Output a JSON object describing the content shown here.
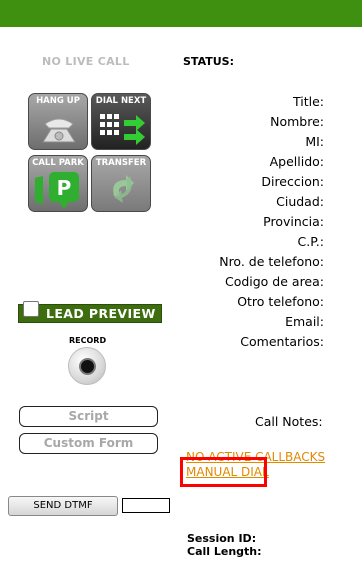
{
  "live_call_status": "NO LIVE CALL",
  "status_label": "STATUS:",
  "buttons": {
    "hang_up": "HANG UP",
    "dial_next": "DIAL NEXT",
    "call_park": "CALL PARK",
    "transfer": "TRANSFER"
  },
  "lead_fields": [
    "Title:",
    "Nombre:",
    "MI:",
    "Apellido:",
    "Direccion:",
    "Ciudad:",
    "Provincia:",
    "C.P.:",
    "Nro. de telefono:",
    "Codigo de area:",
    "Otro telefono:",
    "Email:",
    "Comentarios:"
  ],
  "lead_preview": {
    "label": "LEAD PREVIEW",
    "checked": false
  },
  "record_label": "RECORD",
  "script_button": "Script",
  "custom_form_button": "Custom Form",
  "call_notes_label": "Call Notes:",
  "callbacks_link": "NO ACTIVE CALLBACKS",
  "manual_dial_link": "MANUAL DIAL",
  "send_dtmf_button": "SEND DTMF",
  "dtmf_input_value": "",
  "session_id_label": "Session ID:",
  "call_length_label": "Call Length:",
  "colors": {
    "top_bar": "#3f8f10",
    "lead_preview_bg": "#3d6d0f",
    "link": "#e08a00",
    "highlight": "#ff0000"
  }
}
